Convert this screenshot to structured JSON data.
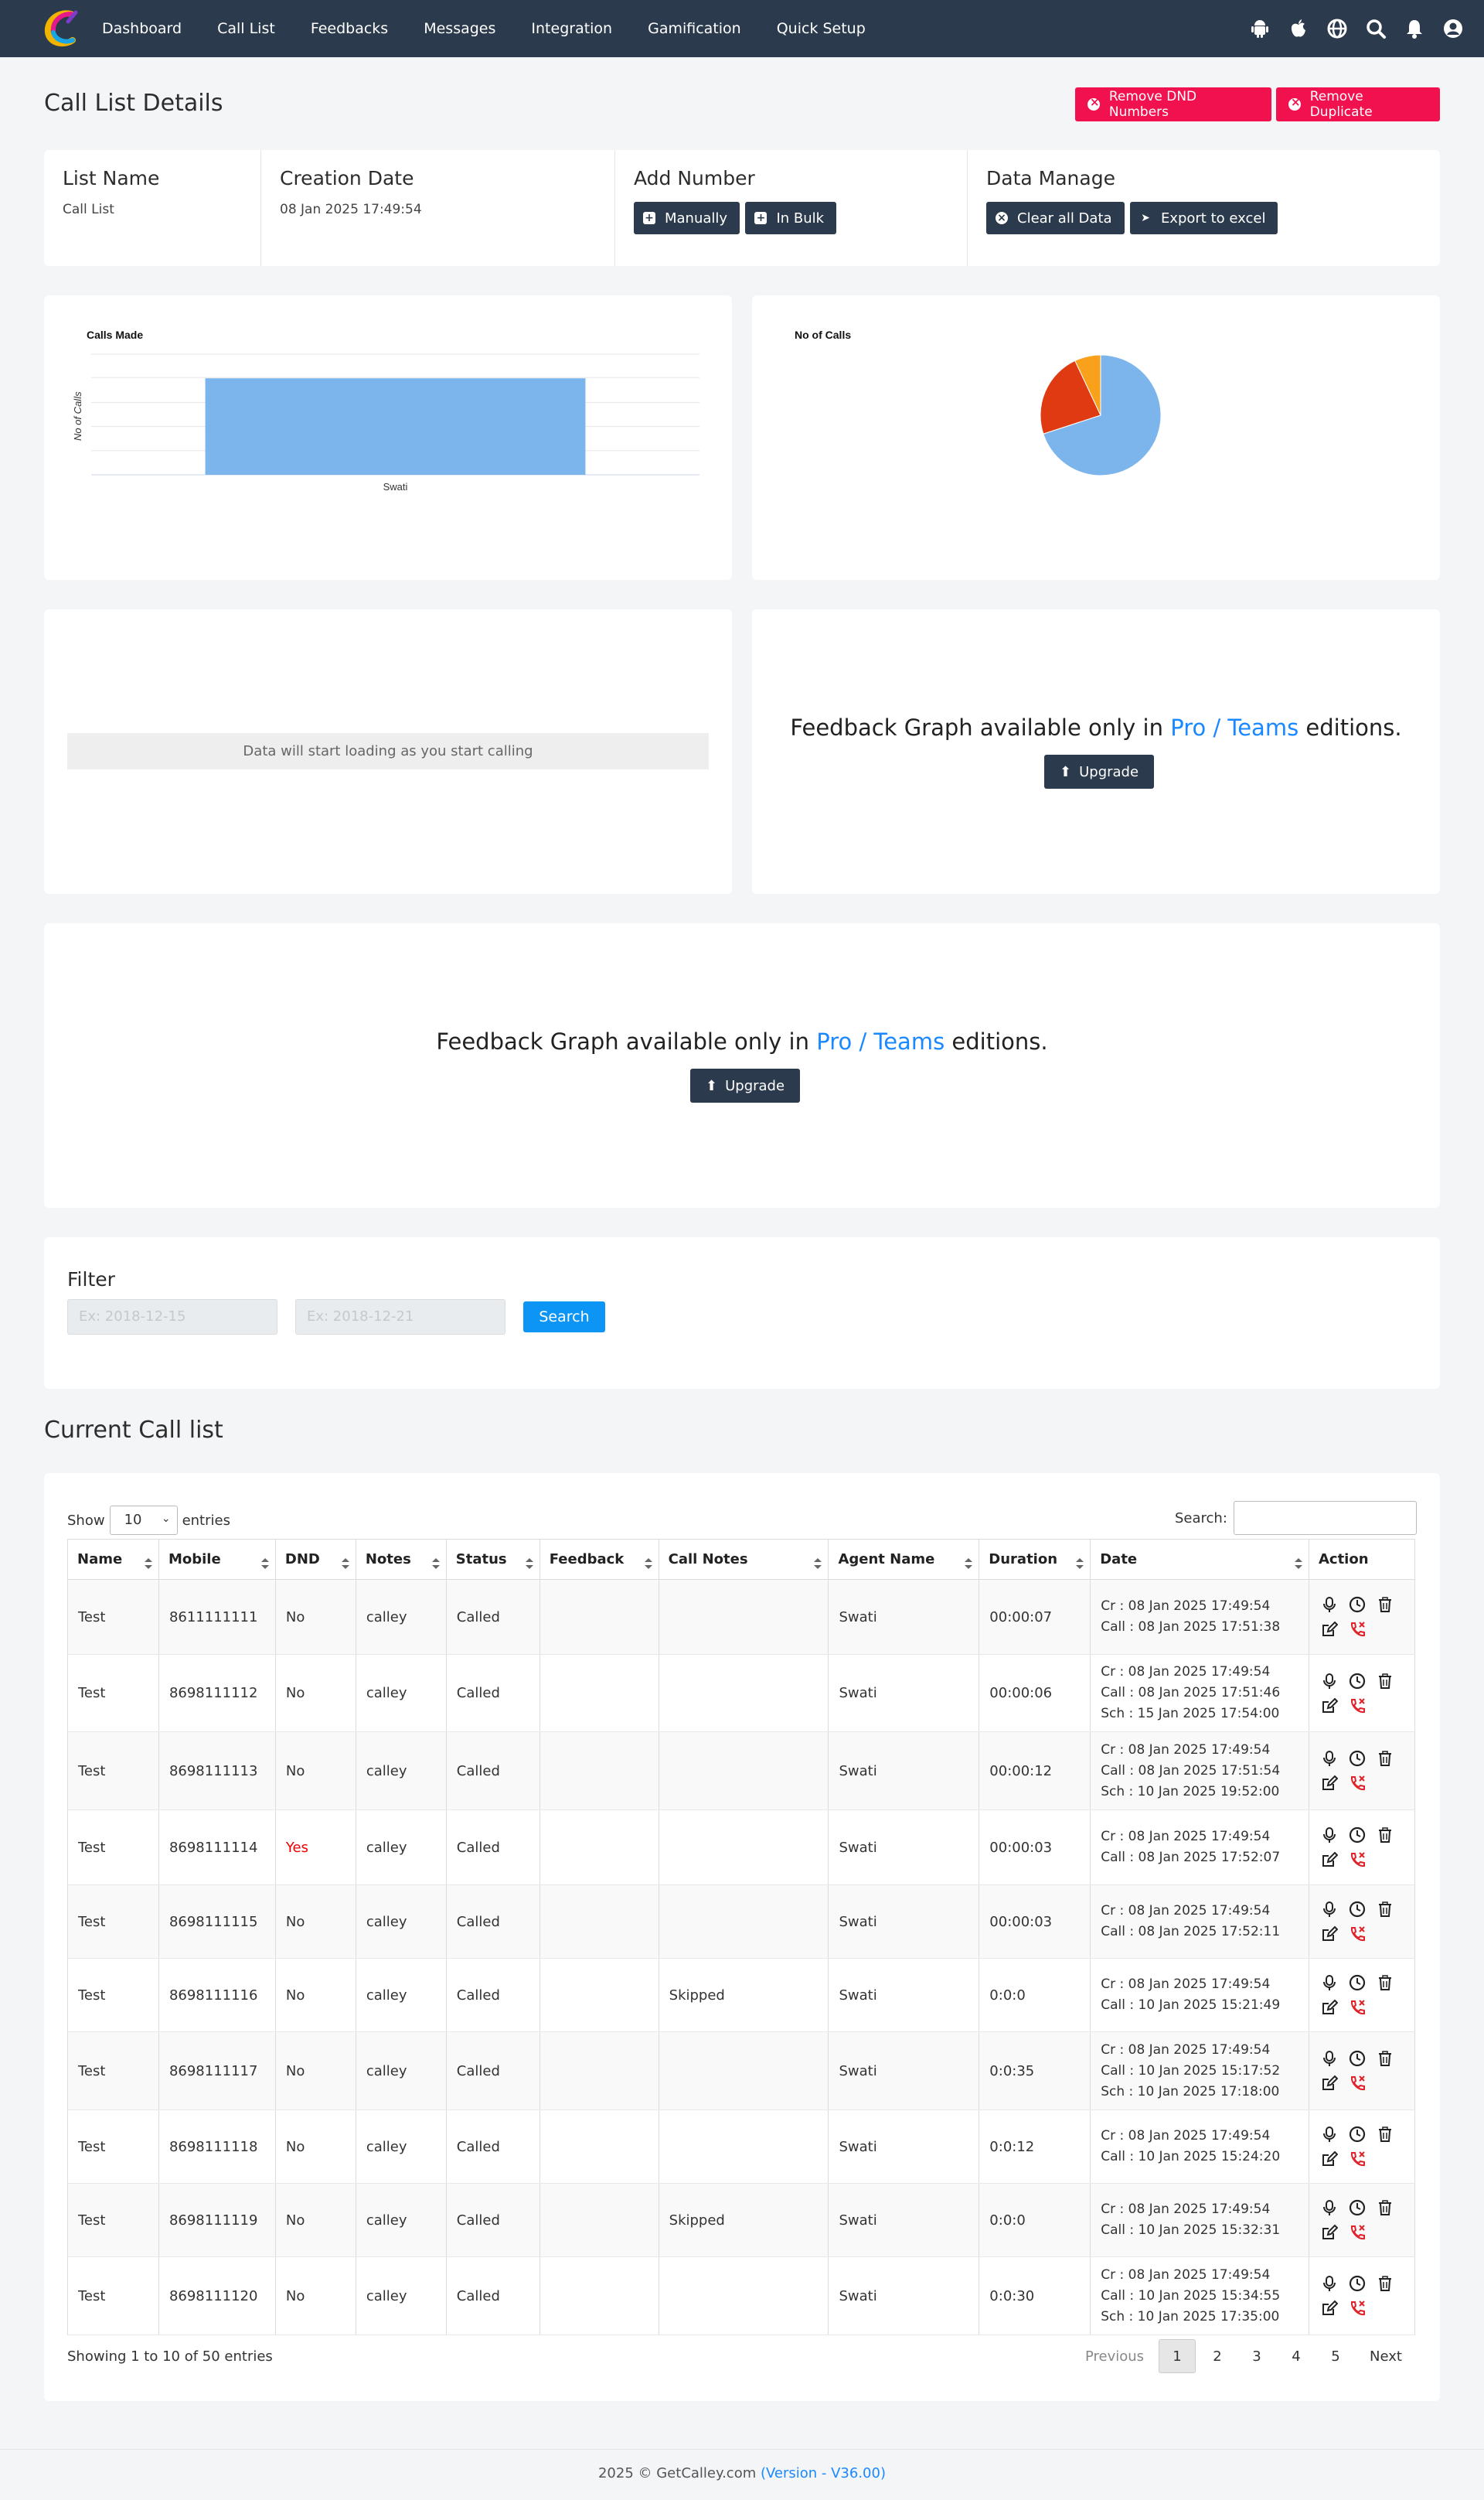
{
  "nav": {
    "items": [
      "Dashboard",
      "Call List",
      "Feedbacks",
      "Messages",
      "Integration",
      "Gamification",
      "Quick Setup"
    ],
    "icons": [
      "android-icon",
      "apple-icon",
      "globe-icon",
      "search-icon",
      "bell-icon",
      "user-icon"
    ]
  },
  "page": {
    "title": "Call List Details",
    "remove_dnd": "Remove DND Numbers",
    "remove_duplicate": "Remove Duplicate"
  },
  "info": {
    "list_name_h": "List Name",
    "list_name_v": "Call List",
    "creation_h": "Creation Date",
    "creation_v": "08 Jan 2025 17:49:54",
    "add_h": "Add Number",
    "manually": "Manually",
    "in_bulk": "In Bulk",
    "manage_h": "Data Manage",
    "clear": "Clear all Data",
    "export": "Export to excel"
  },
  "chart_data": [
    {
      "type": "bar",
      "title": "Calls Made",
      "xlabel": "",
      "ylabel": "No of Calls",
      "categories": [
        "Swati"
      ],
      "values": [
        10
      ],
      "color": "#7cb5ec"
    },
    {
      "type": "pie",
      "title": "No of Calls",
      "slices": [
        {
          "value": 70,
          "color": "#7cb5ec"
        },
        {
          "value": 23,
          "color": "#e03a12"
        },
        {
          "value": 7,
          "color": "#f9a11b"
        }
      ]
    }
  ],
  "loading": "Data will start loading as you start calling",
  "feedback": {
    "pre": "Feedback Graph available only in ",
    "link": "Pro / Teams",
    "post": " editions.",
    "upgrade": "Upgrade"
  },
  "filter": {
    "title": "Filter",
    "from_ph": "Ex: 2018-12-15",
    "to_ph": "Ex: 2018-12-21",
    "search": "Search"
  },
  "list": {
    "title": "Current Call list",
    "show": "Show",
    "entries_value": "10",
    "entries": "entries",
    "search_label": "Search:",
    "columns": [
      "Name",
      "Mobile",
      "DND",
      "Notes",
      "Status",
      "Feedback",
      "Call Notes",
      "Agent Name",
      "Duration",
      "Date",
      "Action"
    ],
    "rows": [
      {
        "name": "Test",
        "mobile": "8611111111",
        "dnd": "No",
        "notes": "calley",
        "status": "Called",
        "feedback": "",
        "call_notes": "",
        "agent": "Swati",
        "duration": "00:00:07",
        "date": [
          "Cr : 08 Jan 2025 17:49:54",
          "Call : 08 Jan 2025 17:51:38"
        ]
      },
      {
        "name": "Test",
        "mobile": "8698111112",
        "dnd": "No",
        "notes": "calley",
        "status": "Called",
        "feedback": "",
        "call_notes": "",
        "agent": "Swati",
        "duration": "00:00:06",
        "date": [
          "Cr : 08 Jan 2025 17:49:54",
          "Call : 08 Jan 2025 17:51:46",
          "Sch : 15 Jan 2025 17:54:00"
        ]
      },
      {
        "name": "Test",
        "mobile": "8698111113",
        "dnd": "No",
        "notes": "calley",
        "status": "Called",
        "feedback": "",
        "call_notes": "",
        "agent": "Swati",
        "duration": "00:00:12",
        "date": [
          "Cr : 08 Jan 2025 17:49:54",
          "Call : 08 Jan 2025 17:51:54",
          "Sch : 10 Jan 2025 19:52:00"
        ]
      },
      {
        "name": "Test",
        "mobile": "8698111114",
        "dnd": "Yes",
        "notes": "calley",
        "status": "Called",
        "feedback": "",
        "call_notes": "",
        "agent": "Swati",
        "duration": "00:00:03",
        "date": [
          "Cr : 08 Jan 2025 17:49:54",
          "Call : 08 Jan 2025 17:52:07"
        ]
      },
      {
        "name": "Test",
        "mobile": "8698111115",
        "dnd": "No",
        "notes": "calley",
        "status": "Called",
        "feedback": "",
        "call_notes": "",
        "agent": "Swati",
        "duration": "00:00:03",
        "date": [
          "Cr : 08 Jan 2025 17:49:54",
          "Call : 08 Jan 2025 17:52:11"
        ]
      },
      {
        "name": "Test",
        "mobile": "8698111116",
        "dnd": "No",
        "notes": "calley",
        "status": "Called",
        "feedback": "",
        "call_notes": "Skipped",
        "agent": "Swati",
        "duration": "0:0:0",
        "date": [
          "Cr : 08 Jan 2025 17:49:54",
          "Call : 10 Jan 2025 15:21:49"
        ]
      },
      {
        "name": "Test",
        "mobile": "8698111117",
        "dnd": "No",
        "notes": "calley",
        "status": "Called",
        "feedback": "",
        "call_notes": "",
        "agent": "Swati",
        "duration": "0:0:35",
        "date": [
          "Cr : 08 Jan 2025 17:49:54",
          "Call : 10 Jan 2025 15:17:52",
          "Sch : 10 Jan 2025 17:18:00"
        ]
      },
      {
        "name": "Test",
        "mobile": "8698111118",
        "dnd": "No",
        "notes": "calley",
        "status": "Called",
        "feedback": "",
        "call_notes": "",
        "agent": "Swati",
        "duration": "0:0:12",
        "date": [
          "Cr : 08 Jan 2025 17:49:54",
          "Call : 10 Jan 2025 15:24:20"
        ]
      },
      {
        "name": "Test",
        "mobile": "8698111119",
        "dnd": "No",
        "notes": "calley",
        "status": "Called",
        "feedback": "",
        "call_notes": "Skipped",
        "agent": "Swati",
        "duration": "0:0:0",
        "date": [
          "Cr : 08 Jan 2025 17:49:54",
          "Call : 10 Jan 2025 15:32:31"
        ]
      },
      {
        "name": "Test",
        "mobile": "8698111120",
        "dnd": "No",
        "notes": "calley",
        "status": "Called",
        "feedback": "",
        "call_notes": "",
        "agent": "Swati",
        "duration": "0:0:30",
        "date": [
          "Cr : 08 Jan 2025 17:49:54",
          "Call : 10 Jan 2025 15:34:55",
          "Sch : 10 Jan 2025 17:35:00"
        ]
      }
    ],
    "showing": "Showing 1 to 10 of 50 entries",
    "pagination": [
      "Previous",
      "1",
      "2",
      "3",
      "4",
      "5",
      "Next"
    ]
  },
  "footer": {
    "text": "2025 © GetCalley.com ",
    "version": "(Version - V36.00)"
  }
}
